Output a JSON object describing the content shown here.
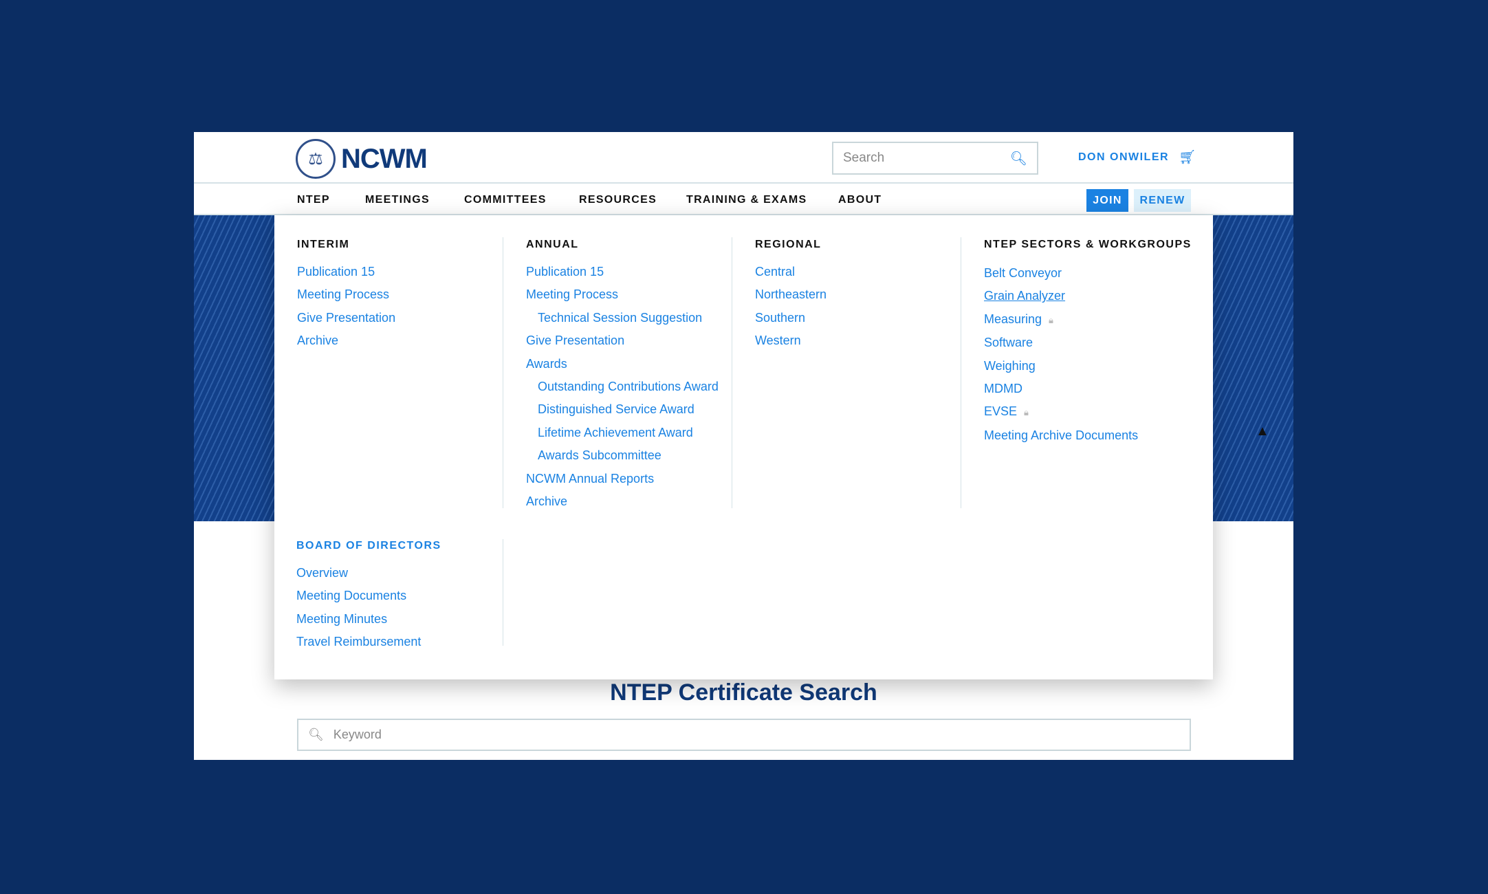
{
  "header": {
    "logo_text": "NCWM",
    "search_placeholder": "Search",
    "user": "DON ONWILER"
  },
  "nav": {
    "items": [
      "NTEP",
      "MEETINGS",
      "COMMITTEES",
      "RESOURCES",
      "TRAINING & EXAMS",
      "ABOUT"
    ],
    "join": "JOIN",
    "renew": "RENEW"
  },
  "menu": {
    "interim": {
      "heading": "INTERIM",
      "links": [
        "Publication 15",
        "Meeting Process",
        "Give Presentation",
        "Archive"
      ]
    },
    "annual": {
      "heading": "ANNUAL",
      "links": [
        "Publication 15",
        "Meeting Process",
        "Technical Session Suggestion",
        "Give Presentation",
        "Awards",
        "Outstanding Contributions Award",
        "Distinguished Service Award",
        "Lifetime Achievement Award",
        "Awards Subcommittee",
        "NCWM Annual Reports",
        "Archive"
      ]
    },
    "regional": {
      "heading": "REGIONAL",
      "links": [
        "Central",
        "Northeastern",
        "Southern",
        "Western"
      ]
    },
    "sectors": {
      "heading": "NTEP SECTORS & WORKGROUPS",
      "links": [
        "Belt Conveyor",
        "Grain Analyzer",
        "Measuring",
        "Software",
        "Weighing",
        "MDMD",
        "EVSE",
        "Meeting Archive Documents"
      ]
    },
    "board": {
      "heading": "BOARD OF DIRECTORS",
      "links": [
        "Overview",
        "Meeting Documents",
        "Meeting Minutes",
        "Travel Reimbursement"
      ]
    }
  },
  "main": {
    "title": "NTEP Certificate Search",
    "keyword_placeholder": "Keyword"
  },
  "colors": {
    "accent": "#1a82e2",
    "brand": "#103a7a",
    "background": "#0b2d63"
  }
}
